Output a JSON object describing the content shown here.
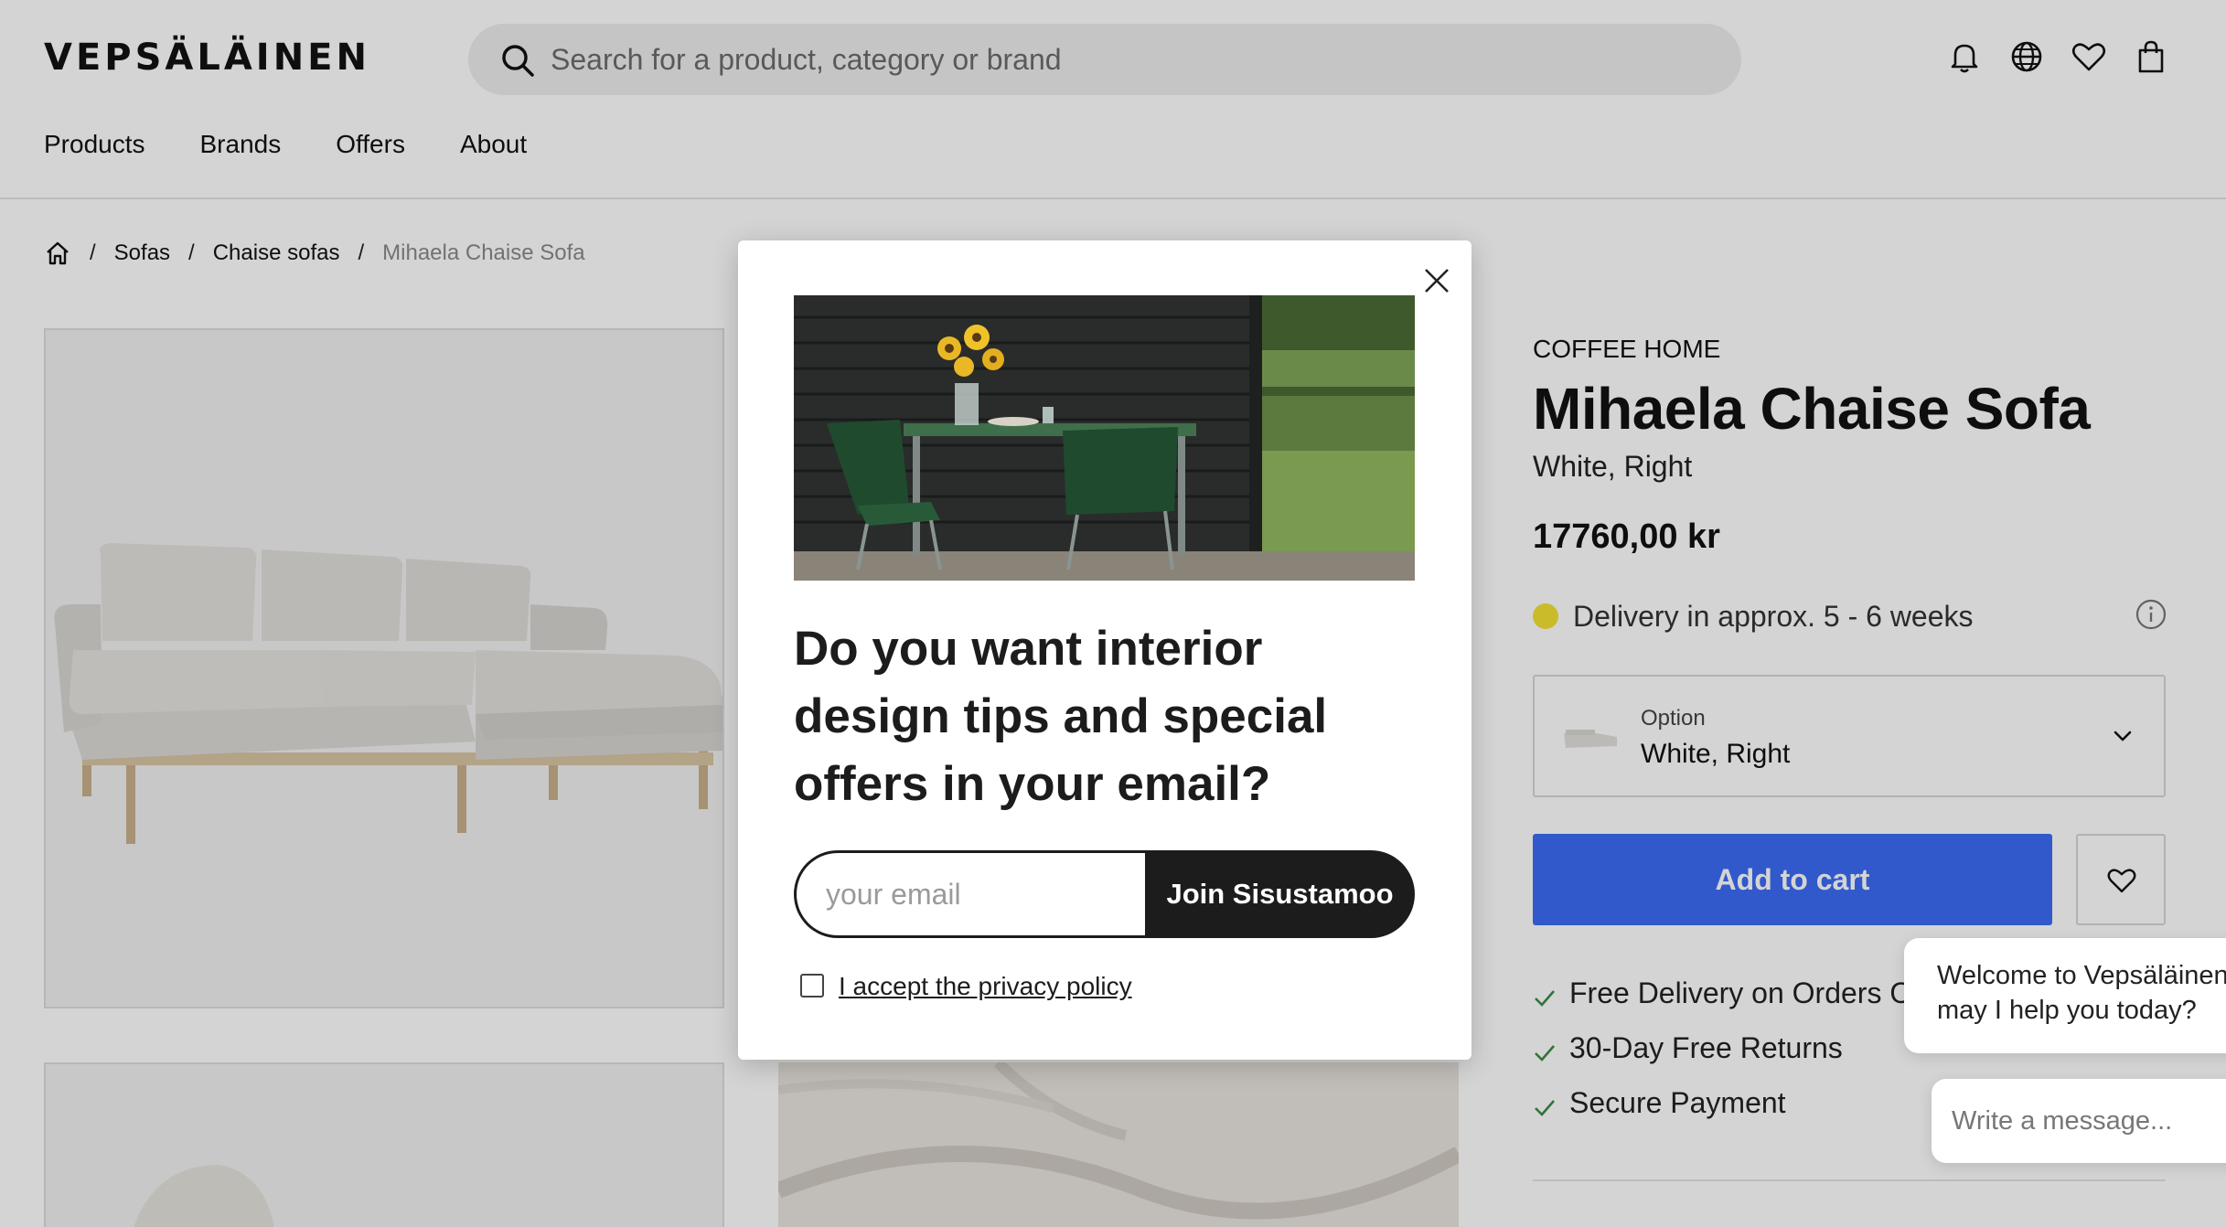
{
  "header": {
    "logo": "VEPSÄLÄINEN",
    "search_placeholder": "Search for a product, category or brand",
    "icons": [
      "bell-icon",
      "globe-icon",
      "heart-icon",
      "bag-icon"
    ]
  },
  "nav": {
    "items": [
      {
        "label": "Products"
      },
      {
        "label": "Brands"
      },
      {
        "label": "Offers"
      },
      {
        "label": "About"
      }
    ]
  },
  "breadcrumb": {
    "items": [
      {
        "label": "Sofas"
      },
      {
        "label": "Chaise sofas"
      },
      {
        "label": "Mihaela Chaise Sofa"
      }
    ]
  },
  "product": {
    "brand": "COFFEE HOME",
    "title": "Mihaela Chaise Sofa",
    "variant": "White, Right",
    "price": "17760,00 kr",
    "delivery": "Delivery in approx. 5 - 6 weeks",
    "delivery_status_color": "#f2e132",
    "option_label": "Option",
    "option_value": "White, Right",
    "add_to_cart": "Add to cart",
    "accent_color": "#3b6cf5",
    "perks": [
      "Free Delivery on Orders Over",
      "30-Day Free Returns",
      "Secure Payment"
    ]
  },
  "modal": {
    "headline": "Do you want interior design tips and special offers in your email?",
    "email_placeholder": "your email",
    "join_label": "Join Sisustamoo",
    "privacy_label": "I accept the privacy policy"
  },
  "chat": {
    "welcome": "Welcome to Vepsäläinen may I help you today?",
    "input_placeholder": "Write a message..."
  }
}
